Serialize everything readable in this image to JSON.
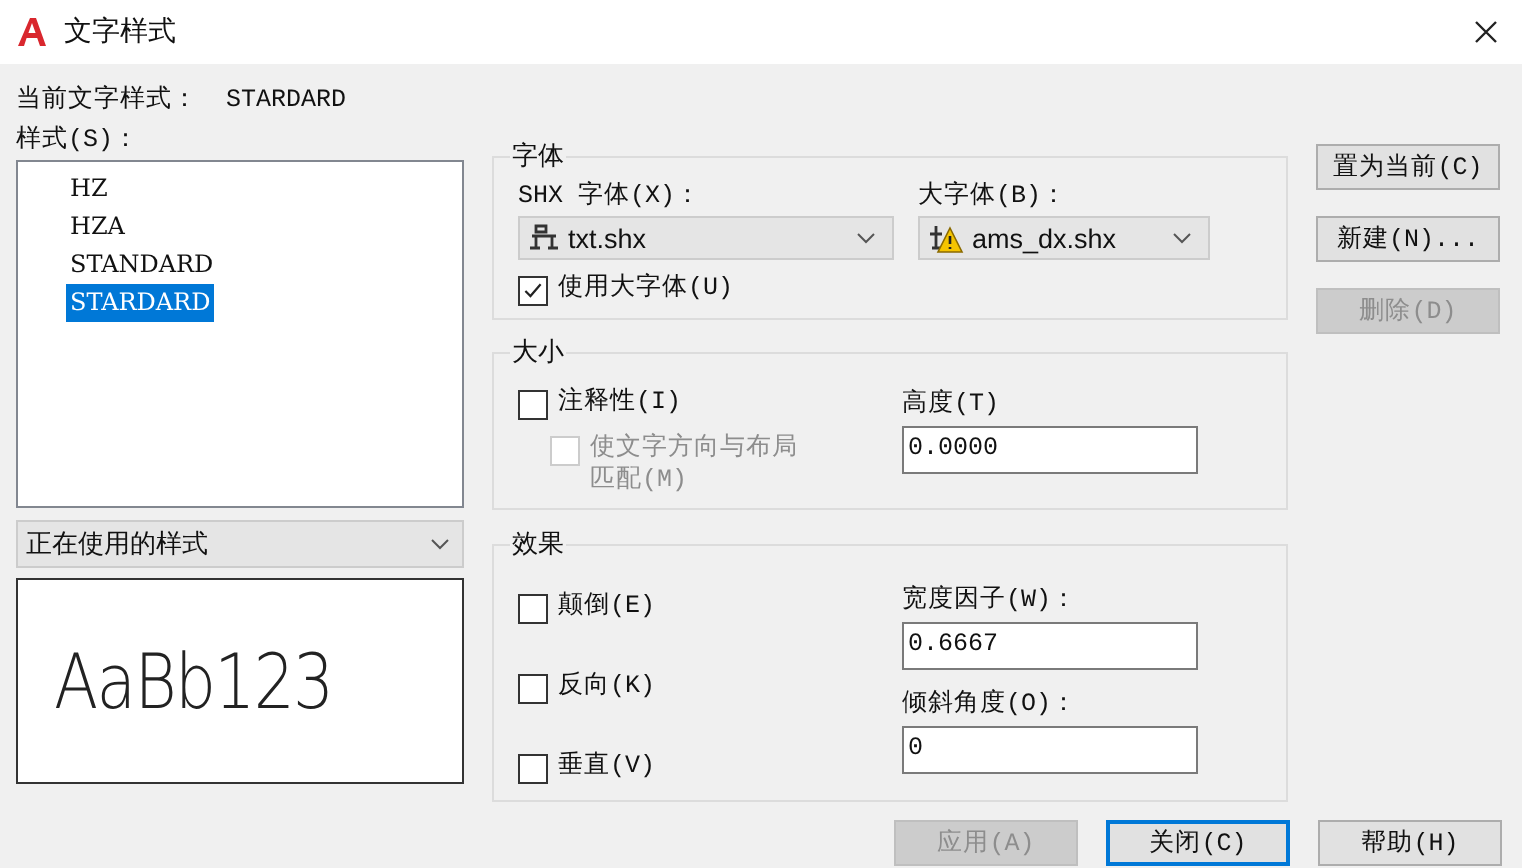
{
  "window": {
    "title": "文字样式"
  },
  "current_style": {
    "label": "当前文字样式：",
    "value": "STARDARD"
  },
  "styles": {
    "label": "样式(S)：",
    "items": [
      {
        "label": "HZ",
        "selected": false
      },
      {
        "label": "HZA",
        "selected": false
      },
      {
        "label": "STANDARD",
        "selected": false
      },
      {
        "label": "STARDARD",
        "selected": true
      }
    ]
  },
  "filter": {
    "value": "正在使用的样式"
  },
  "preview": {
    "text": "AaBb123"
  },
  "font": {
    "title": "字体",
    "shx_label": "SHX 字体(X)：",
    "shx_value": "txt.shx",
    "big_label": "大字体(B)：",
    "big_value": "ams_dx.shx",
    "use_big": {
      "label": "使用大字体(U)",
      "checked": true,
      "disabled": false
    }
  },
  "size": {
    "title": "大小",
    "options": [
      {
        "label": "注释性(I)",
        "checked": false,
        "disabled": false
      },
      {
        "label": "使文字方向与布局匹配(M)",
        "checked": false,
        "disabled": true
      }
    ],
    "height": {
      "label": "高度(T)",
      "value": "0.0000"
    }
  },
  "effects": {
    "title": "效果",
    "options": [
      {
        "label": "颠倒(E)",
        "checked": false,
        "disabled": false
      },
      {
        "label": "反向(K)",
        "checked": false,
        "disabled": false
      },
      {
        "label": "垂直(V)",
        "checked": false,
        "disabled": false
      }
    ],
    "fields": [
      {
        "label": "宽度因子(W)：",
        "value": "0.6667"
      },
      {
        "label": "倾斜角度(O)：",
        "value": "0"
      }
    ]
  },
  "side_buttons": [
    {
      "label": "置为当前(C)",
      "disabled": false
    },
    {
      "label": "新建(N)...",
      "disabled": false
    },
    {
      "label": "删除(D)",
      "disabled": true
    }
  ],
  "bottom_buttons": [
    {
      "label": "应用(A)",
      "disabled": true,
      "default": false
    },
    {
      "label": "关闭(C)",
      "disabled": false,
      "default": true
    },
    {
      "label": "帮助(H)",
      "disabled": false,
      "default": false
    }
  ]
}
